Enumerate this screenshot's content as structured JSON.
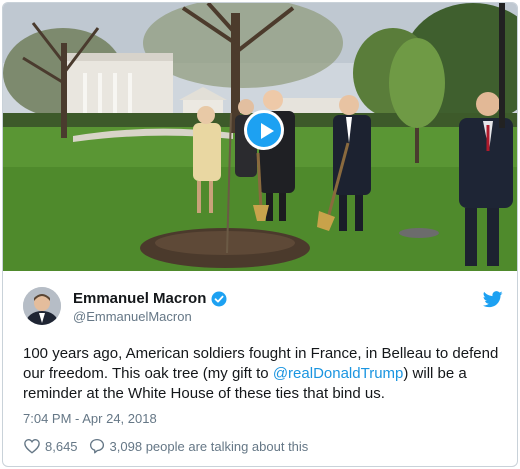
{
  "tweet": {
    "author_name": "Emmanuel Macron",
    "author_handle": "@EmmanuelMacron",
    "text_before": "100 years ago, American soldiers fought in France, in Belleau to defend our freedom. This oak tree (my gift to ",
    "mention": "@realDonaldTrump",
    "text_after": ") will be a reminder at the White House of these ties that bind us.",
    "timestamp": "7:04 PM - Apr 24, 2018",
    "likes": "8,645",
    "talking": "3,098 people are talking about this"
  },
  "media": {
    "type": "video",
    "play_icon": "play-icon"
  },
  "icons": {
    "verified": "verified-badge-icon",
    "twitter": "twitter-bird-icon",
    "like": "heart-icon",
    "reply": "speech-bubble-icon"
  },
  "colors": {
    "accent": "#1da1f2",
    "link": "#1b95e0",
    "text": "#14171a",
    "secondary": "#657786",
    "border": "#c9d2d9"
  }
}
